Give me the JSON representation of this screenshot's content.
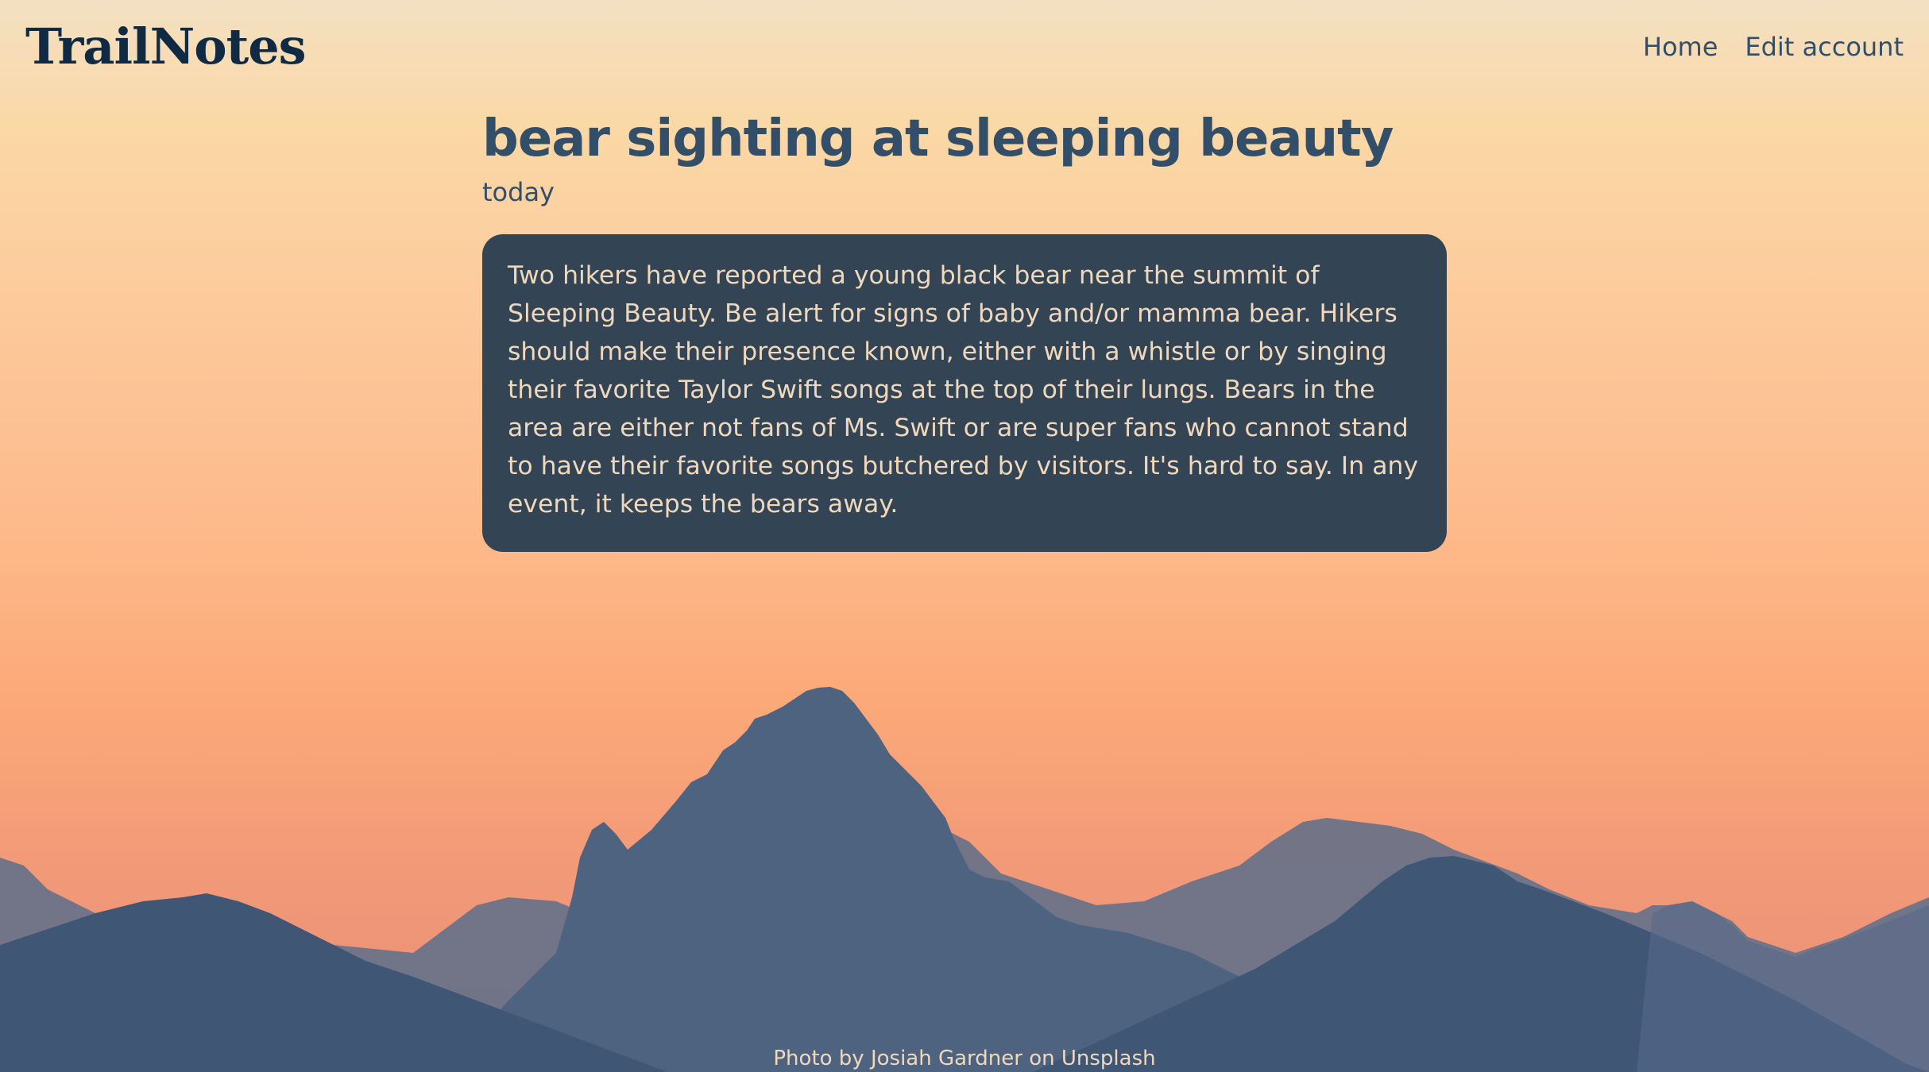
{
  "header": {
    "logo": "TrailNotes",
    "nav": [
      {
        "label": "Home"
      },
      {
        "label": "Edit account"
      }
    ]
  },
  "post": {
    "title": "bear sighting at sleeping beauty",
    "date": "today",
    "body": "Two hikers have reported a young black bear near the summit of Sleeping Beauty. Be alert for signs of baby and/or mamma bear. Hikers should make their presence known, either with a whistle or by singing their favorite Taylor Swift songs at the top of their lungs. Bears in the area are either not fans of Ms. Swift or are super fans who cannot stand to have their favorite songs butchered by visitors. It's hard to say. In any event, it keeps the bears away."
  },
  "footer": {
    "credit": "Photo by Josiah Gardner on Unsplash"
  },
  "colors": {
    "brand": "#102a43",
    "text": "#334e68",
    "card_bg": "#334455",
    "card_text": "#f0d8bd"
  }
}
